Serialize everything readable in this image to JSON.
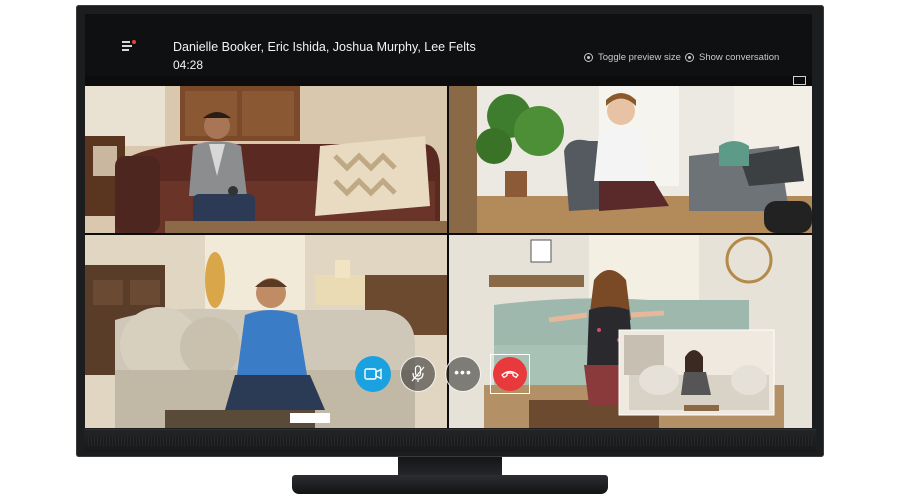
{
  "call": {
    "participants": "Danielle Booker, Eric Ishida, Joshua Murphy, Lee Felts",
    "duration": "04:28"
  },
  "top_actions": {
    "toggle_preview": "Toggle preview size",
    "show_conversation": "Show conversation"
  },
  "controls": {
    "video": "video-camera-icon",
    "mute": "microphone-icon",
    "more": "more-options-icon",
    "hangup": "hang-up-icon"
  },
  "colors": {
    "accent_blue": "#1aa1e0",
    "hangup_red": "#e8393c",
    "notification_red": "#e8413b"
  }
}
